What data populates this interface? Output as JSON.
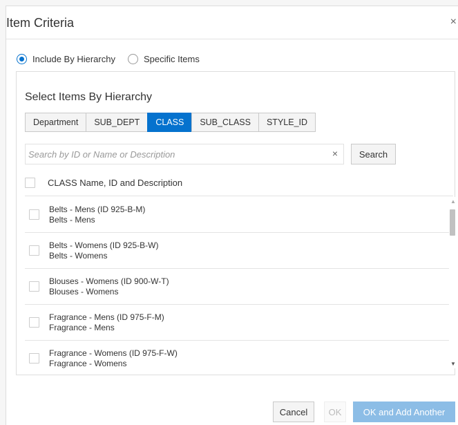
{
  "dialog": {
    "title": "Item Criteria",
    "close_icon": "×"
  },
  "mode": {
    "options": [
      {
        "label": "Include By Hierarchy",
        "selected": true
      },
      {
        "label": "Specific Items",
        "selected": false
      }
    ]
  },
  "hierarchy": {
    "title": "Select Items By Hierarchy",
    "tabs": [
      {
        "label": "Department",
        "active": false
      },
      {
        "label": "SUB_DEPT",
        "active": false
      },
      {
        "label": "CLASS",
        "active": true
      },
      {
        "label": "SUB_CLASS",
        "active": false
      },
      {
        "label": "STYLE_ID",
        "active": false
      }
    ],
    "search": {
      "placeholder": "Search by ID or Name or Description",
      "value": "",
      "clear_icon": "×",
      "button_label": "Search"
    },
    "list_header": "CLASS Name, ID and Description",
    "items": [
      {
        "line1": "Belts - Mens (ID 925-B-M)",
        "line2": "Belts - Mens",
        "checked": false
      },
      {
        "line1": "Belts - Womens (ID 925-B-W)",
        "line2": "Belts - Womens",
        "checked": false
      },
      {
        "line1": "Blouses - Womens (ID 900-W-T)",
        "line2": "Blouses - Womens",
        "checked": false
      },
      {
        "line1": "Fragrance - Mens (ID 975-F-M)",
        "line2": "Fragrance - Mens",
        "checked": false
      },
      {
        "line1": "Fragrance - Womens (ID 975-F-W)",
        "line2": "Fragrance - Womens",
        "checked": false
      }
    ]
  },
  "footer": {
    "cancel_label": "Cancel",
    "ok_label": "OK",
    "ok_add_label": "OK and Add Another"
  },
  "colors": {
    "accent": "#0572ce",
    "disabled_primary": "#8cbde6"
  }
}
